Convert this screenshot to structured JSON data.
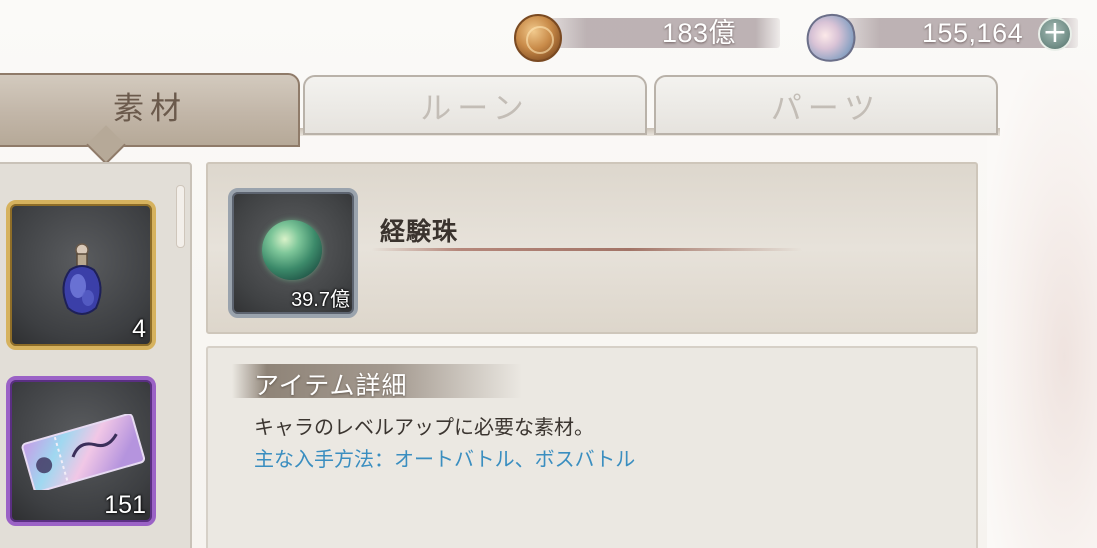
{
  "currency": {
    "gold": {
      "icon": "gold-coin-icon",
      "value": "183億"
    },
    "gems": {
      "icon": "gem-icon",
      "value": "155,164",
      "add_label": "+"
    }
  },
  "tabs": [
    {
      "label": "素材",
      "active": true
    },
    {
      "label": "ルーン",
      "active": false
    },
    {
      "label": "パーツ",
      "active": false
    }
  ],
  "inventory": [
    {
      "icon": "potion-icon",
      "count": "4",
      "rarity": "gold"
    },
    {
      "icon": "ticket-icon",
      "count": "151",
      "rarity": "purple"
    }
  ],
  "selected_item": {
    "icon": "experience-orb-icon",
    "name": "経験珠",
    "count": "39.7億"
  },
  "detail": {
    "section_title": "アイテム詳細",
    "description": "キャラのレベルアップに必要な素材。",
    "source": "主な入手方法：オートバトル、ボスバトル"
  },
  "colors": {
    "tab_active_text": "#6b5a4c",
    "tab_inactive_text": "#c3bdb6",
    "gold_frame": "#d6b25e",
    "purple_frame": "#9b62c6",
    "source_text": "#3a8ec0"
  }
}
